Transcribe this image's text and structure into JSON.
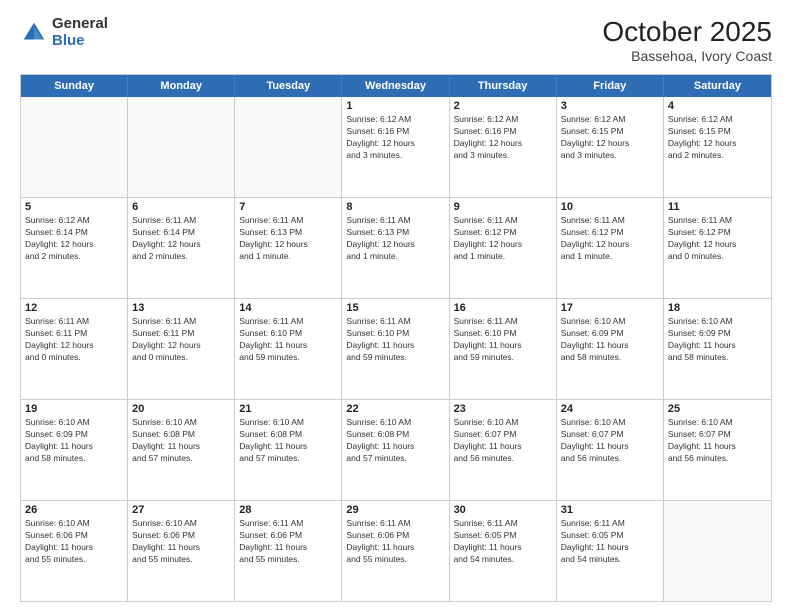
{
  "header": {
    "logo_general": "General",
    "logo_blue": "Blue",
    "title": "October 2025",
    "subtitle": "Bassehoa, Ivory Coast"
  },
  "calendar": {
    "weekdays": [
      "Sunday",
      "Monday",
      "Tuesday",
      "Wednesday",
      "Thursday",
      "Friday",
      "Saturday"
    ],
    "rows": [
      [
        {
          "day": "",
          "info": "",
          "empty": true
        },
        {
          "day": "",
          "info": "",
          "empty": true
        },
        {
          "day": "",
          "info": "",
          "empty": true
        },
        {
          "day": "1",
          "info": "Sunrise: 6:12 AM\nSunset: 6:16 PM\nDaylight: 12 hours\nand 3 minutes."
        },
        {
          "day": "2",
          "info": "Sunrise: 6:12 AM\nSunset: 6:16 PM\nDaylight: 12 hours\nand 3 minutes."
        },
        {
          "day": "3",
          "info": "Sunrise: 6:12 AM\nSunset: 6:15 PM\nDaylight: 12 hours\nand 3 minutes."
        },
        {
          "day": "4",
          "info": "Sunrise: 6:12 AM\nSunset: 6:15 PM\nDaylight: 12 hours\nand 2 minutes."
        }
      ],
      [
        {
          "day": "5",
          "info": "Sunrise: 6:12 AM\nSunset: 6:14 PM\nDaylight: 12 hours\nand 2 minutes."
        },
        {
          "day": "6",
          "info": "Sunrise: 6:11 AM\nSunset: 6:14 PM\nDaylight: 12 hours\nand 2 minutes."
        },
        {
          "day": "7",
          "info": "Sunrise: 6:11 AM\nSunset: 6:13 PM\nDaylight: 12 hours\nand 1 minute."
        },
        {
          "day": "8",
          "info": "Sunrise: 6:11 AM\nSunset: 6:13 PM\nDaylight: 12 hours\nand 1 minute."
        },
        {
          "day": "9",
          "info": "Sunrise: 6:11 AM\nSunset: 6:12 PM\nDaylight: 12 hours\nand 1 minute."
        },
        {
          "day": "10",
          "info": "Sunrise: 6:11 AM\nSunset: 6:12 PM\nDaylight: 12 hours\nand 1 minute."
        },
        {
          "day": "11",
          "info": "Sunrise: 6:11 AM\nSunset: 6:12 PM\nDaylight: 12 hours\nand 0 minutes."
        }
      ],
      [
        {
          "day": "12",
          "info": "Sunrise: 6:11 AM\nSunset: 6:11 PM\nDaylight: 12 hours\nand 0 minutes."
        },
        {
          "day": "13",
          "info": "Sunrise: 6:11 AM\nSunset: 6:11 PM\nDaylight: 12 hours\nand 0 minutes."
        },
        {
          "day": "14",
          "info": "Sunrise: 6:11 AM\nSunset: 6:10 PM\nDaylight: 11 hours\nand 59 minutes."
        },
        {
          "day": "15",
          "info": "Sunrise: 6:11 AM\nSunset: 6:10 PM\nDaylight: 11 hours\nand 59 minutes."
        },
        {
          "day": "16",
          "info": "Sunrise: 6:11 AM\nSunset: 6:10 PM\nDaylight: 11 hours\nand 59 minutes."
        },
        {
          "day": "17",
          "info": "Sunrise: 6:10 AM\nSunset: 6:09 PM\nDaylight: 11 hours\nand 58 minutes."
        },
        {
          "day": "18",
          "info": "Sunrise: 6:10 AM\nSunset: 6:09 PM\nDaylight: 11 hours\nand 58 minutes."
        }
      ],
      [
        {
          "day": "19",
          "info": "Sunrise: 6:10 AM\nSunset: 6:09 PM\nDaylight: 11 hours\nand 58 minutes."
        },
        {
          "day": "20",
          "info": "Sunrise: 6:10 AM\nSunset: 6:08 PM\nDaylight: 11 hours\nand 57 minutes."
        },
        {
          "day": "21",
          "info": "Sunrise: 6:10 AM\nSunset: 6:08 PM\nDaylight: 11 hours\nand 57 minutes."
        },
        {
          "day": "22",
          "info": "Sunrise: 6:10 AM\nSunset: 6:08 PM\nDaylight: 11 hours\nand 57 minutes."
        },
        {
          "day": "23",
          "info": "Sunrise: 6:10 AM\nSunset: 6:07 PM\nDaylight: 11 hours\nand 56 minutes."
        },
        {
          "day": "24",
          "info": "Sunrise: 6:10 AM\nSunset: 6:07 PM\nDaylight: 11 hours\nand 56 minutes."
        },
        {
          "day": "25",
          "info": "Sunrise: 6:10 AM\nSunset: 6:07 PM\nDaylight: 11 hours\nand 56 minutes."
        }
      ],
      [
        {
          "day": "26",
          "info": "Sunrise: 6:10 AM\nSunset: 6:06 PM\nDaylight: 11 hours\nand 55 minutes."
        },
        {
          "day": "27",
          "info": "Sunrise: 6:10 AM\nSunset: 6:06 PM\nDaylight: 11 hours\nand 55 minutes."
        },
        {
          "day": "28",
          "info": "Sunrise: 6:11 AM\nSunset: 6:06 PM\nDaylight: 11 hours\nand 55 minutes."
        },
        {
          "day": "29",
          "info": "Sunrise: 6:11 AM\nSunset: 6:06 PM\nDaylight: 11 hours\nand 55 minutes."
        },
        {
          "day": "30",
          "info": "Sunrise: 6:11 AM\nSunset: 6:05 PM\nDaylight: 11 hours\nand 54 minutes."
        },
        {
          "day": "31",
          "info": "Sunrise: 6:11 AM\nSunset: 6:05 PM\nDaylight: 11 hours\nand 54 minutes."
        },
        {
          "day": "",
          "info": "",
          "empty": true
        }
      ]
    ]
  }
}
